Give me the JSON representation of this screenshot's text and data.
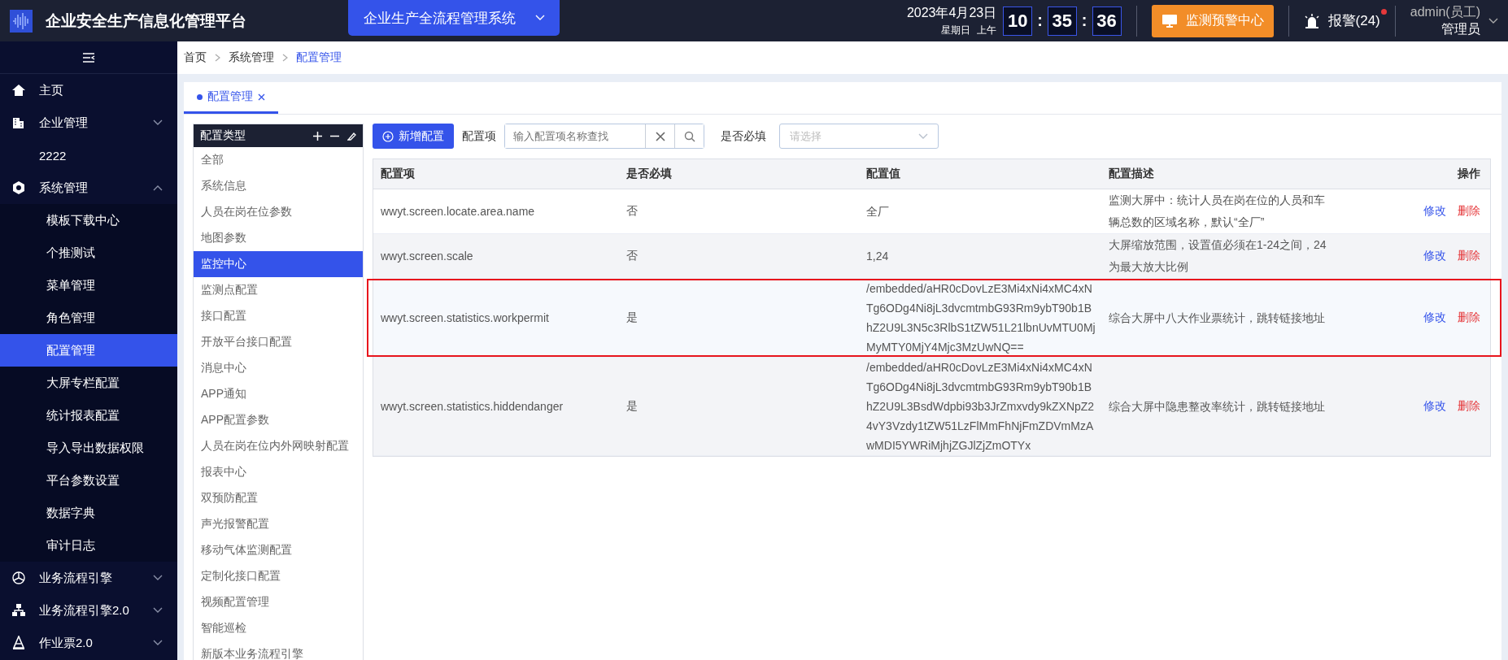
{
  "header": {
    "app_title": "企业安全生产信息化管理平台",
    "system_dropdown": "企业生产全流程管理系统",
    "date": "2023年4月23日",
    "weekday": "星期日",
    "ampm": "上午",
    "time": {
      "hours": "10",
      "minutes": "35",
      "seconds": "36",
      "separator": ":"
    },
    "monitor_button": "监测预警中心",
    "alarm": {
      "label": "报警(24)",
      "unread": true
    },
    "user": {
      "name": "admin(员工)",
      "role": "管理员"
    }
  },
  "sidebar": {
    "items": [
      {
        "label": "主页",
        "selected": false
      },
      {
        "label": "企业管理",
        "selected": false,
        "expanded": false
      },
      {
        "label": "2222",
        "selected": false
      },
      {
        "label": "系统管理",
        "selected": false,
        "expanded": true,
        "children": [
          {
            "label": "模板下载中心",
            "selected": false
          },
          {
            "label": "个推测试",
            "selected": false
          },
          {
            "label": "菜单管理",
            "selected": false
          },
          {
            "label": "角色管理",
            "selected": false
          },
          {
            "label": "配置管理",
            "selected": true
          },
          {
            "label": "大屏专栏配置",
            "selected": false
          },
          {
            "label": "统计报表配置",
            "selected": false
          },
          {
            "label": "导入导出数据权限",
            "selected": false
          },
          {
            "label": "平台参数设置",
            "selected": false
          },
          {
            "label": "数据字典",
            "selected": false
          },
          {
            "label": "审计日志",
            "selected": false
          }
        ]
      },
      {
        "label": "业务流程引擎",
        "selected": false,
        "expanded": false
      },
      {
        "label": "业务流程引擎2.0",
        "selected": false,
        "expanded": false
      },
      {
        "label": "作业票2.0",
        "selected": false,
        "expanded": false
      }
    ]
  },
  "breadcrumb": [
    {
      "label": "首页",
      "current": false
    },
    {
      "label": "系统管理",
      "current": false
    },
    {
      "label": "配置管理",
      "current": true
    }
  ],
  "tabs": [
    {
      "label": "配置管理",
      "selected": true
    }
  ],
  "config_types": {
    "title": "配置类型",
    "items": [
      {
        "label": "全部",
        "selected": false
      },
      {
        "label": "系统信息",
        "selected": false
      },
      {
        "label": "人员在岗在位参数",
        "selected": false
      },
      {
        "label": "地图参数",
        "selected": false
      },
      {
        "label": "监控中心",
        "selected": true
      },
      {
        "label": "监测点配置",
        "selected": false
      },
      {
        "label": "接口配置",
        "selected": false
      },
      {
        "label": "开放平台接口配置",
        "selected": false
      },
      {
        "label": "消息中心",
        "selected": false
      },
      {
        "label": "APP通知",
        "selected": false
      },
      {
        "label": "APP配置参数",
        "selected": false
      },
      {
        "label": "人员在岗在位内外网映射配置",
        "selected": false
      },
      {
        "label": "报表中心",
        "selected": false
      },
      {
        "label": "双预防配置",
        "selected": false
      },
      {
        "label": "声光报警配置",
        "selected": false
      },
      {
        "label": "移动气体监测配置",
        "selected": false
      },
      {
        "label": "定制化接口配置",
        "selected": false
      },
      {
        "label": "视频配置管理",
        "selected": false
      },
      {
        "label": "智能巡检",
        "selected": false
      },
      {
        "label": "新版本业务流程引擎",
        "selected": false
      }
    ]
  },
  "toolbar": {
    "add_button": "新增配置",
    "search_label": "配置项",
    "search": {
      "placeholder": "输入配置项名称查找"
    },
    "required_label": "是否必填",
    "required_select": {
      "placeholder": "请选择"
    }
  },
  "table": {
    "columns": [
      "配置项",
      "是否必填",
      "配置值",
      "配置描述",
      "操作"
    ],
    "rows": [
      {
        "key": "wwyt.screen.locate.area.name",
        "required": "否",
        "value": "全厂",
        "description": "监测大屏中：统计人员在岗在位的人员和车辆总数的区域名称，默认“全厂”",
        "actions": [
          "修改",
          "删除"
        ],
        "highlighted": false
      },
      {
        "key": "wwyt.screen.scale",
        "required": "否",
        "value": "1,24",
        "description": "大屏缩放范围，设置值必须在1-24之间，24为最大放大比例",
        "actions": [
          "修改",
          "删除"
        ],
        "highlighted": false
      },
      {
        "key": "wwyt.screen.statistics.workpermit",
        "required": "是",
        "value": "/embedded/aHR0cDovLzE3Mi4xNi4xMC4xNTg6ODg4Ni8jL3dvcmtmbG93Rm9ybT90b1BhZ2U9L3N5c3RlbS1tZW51L21lbnUvMTU0MjMyMTY0MjY4Mjc3MzUwNQ==",
        "description": "综合大屏中八大作业票统计，跳转链接地址",
        "actions": [
          "修改",
          "删除"
        ],
        "highlighted": true
      },
      {
        "key": "wwyt.screen.statistics.hiddendanger",
        "required": "是",
        "value": "/embedded/aHR0cDovLzE3Mi4xNi4xMC4xNTg6ODg4Ni8jL3dvcmtmbG93Rm9ybT90b1BhZ2U9L3BsdWdpbi93b3JrZmxvdy9kZXNpZ24vY3Vzdy1tZW51LzFlMmFhNjFmZDVmMzAwMDI5YWRiMjhjZGJlZjZmOTYx",
        "description": "综合大屏中隐患整改率统计，跳转链接地址",
        "actions": [
          "修改",
          "删除"
        ],
        "highlighted": false
      }
    ]
  }
}
